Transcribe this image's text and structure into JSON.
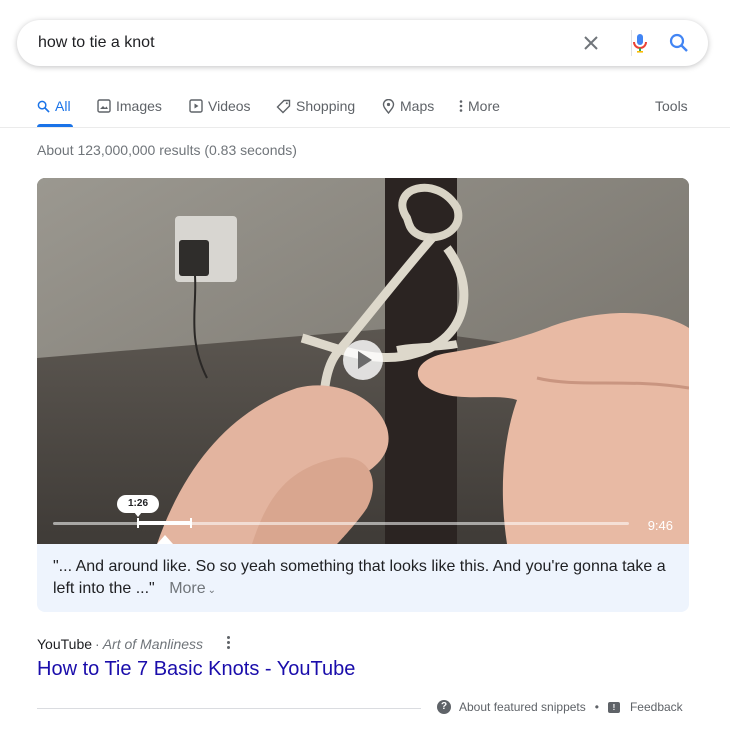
{
  "search": {
    "query": "how to tie a knot"
  },
  "tabs": [
    {
      "label": "All",
      "icon": "search-icon",
      "active": true
    },
    {
      "label": "Images",
      "icon": "image-icon"
    },
    {
      "label": "Videos",
      "icon": "video-icon"
    },
    {
      "label": "Shopping",
      "icon": "tag-icon"
    },
    {
      "label": "Maps",
      "icon": "map-pin-icon"
    },
    {
      "label": "More",
      "icon": "vertical-dots-icon"
    }
  ],
  "tools_label": "Tools",
  "result_stats": "About 123,000,000 results (0.83 seconds)",
  "video": {
    "timestamp_tooltip": "1:26",
    "duration": "9:46"
  },
  "transcript": {
    "text": "\"... And around like. So so yeah something that looks like this. And you're gonna take a left into the ...\"",
    "more_label": "More"
  },
  "result": {
    "source": "YouTube",
    "channel": "Art of Manliness",
    "title": "How to Tie 7 Basic Knots - YouTube"
  },
  "footer": {
    "about_label": "About featured snippets",
    "separator": "•",
    "feedback_label": "Feedback"
  },
  "colors": {
    "accent": "#1a73e8",
    "link": "#1a0dab",
    "transcript_bg": "#eef4fd"
  }
}
